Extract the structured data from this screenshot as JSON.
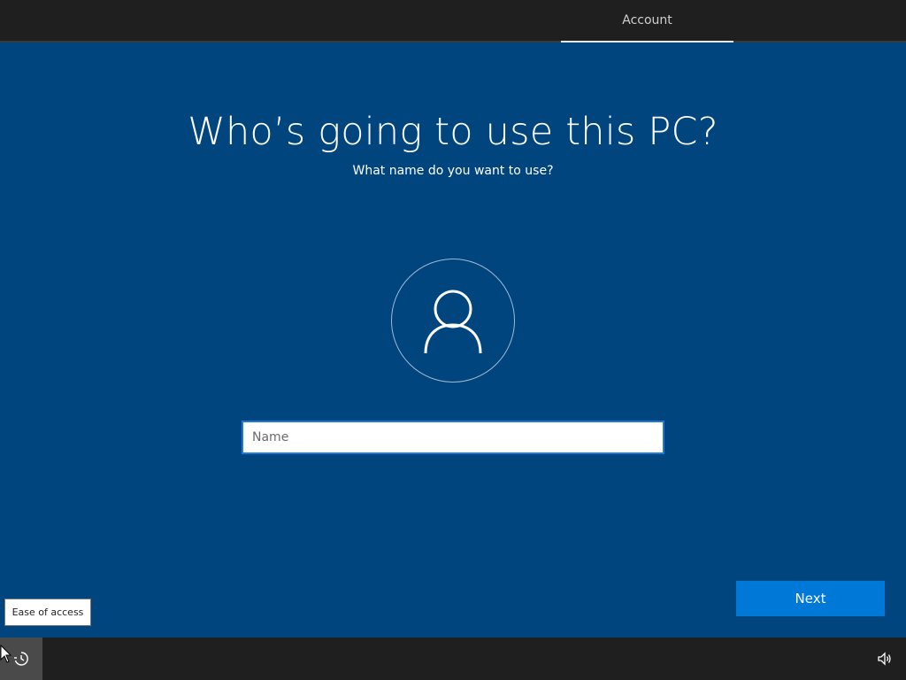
{
  "header": {
    "active_tab": "Account"
  },
  "main": {
    "title": "Who’s going to use this PC?",
    "subtitle": "What name do you want to use?",
    "avatar_icon": "user-icon",
    "name_placeholder": "Name",
    "name_value": ""
  },
  "footer": {
    "next_label": "Next",
    "ease_tooltip": "Ease of access",
    "ease_icon": "ease-of-access-icon",
    "volume_icon": "volume-icon"
  },
  "colors": {
    "background": "#00457e",
    "accent": "#0078d7",
    "bar": "#1f1f1f"
  }
}
